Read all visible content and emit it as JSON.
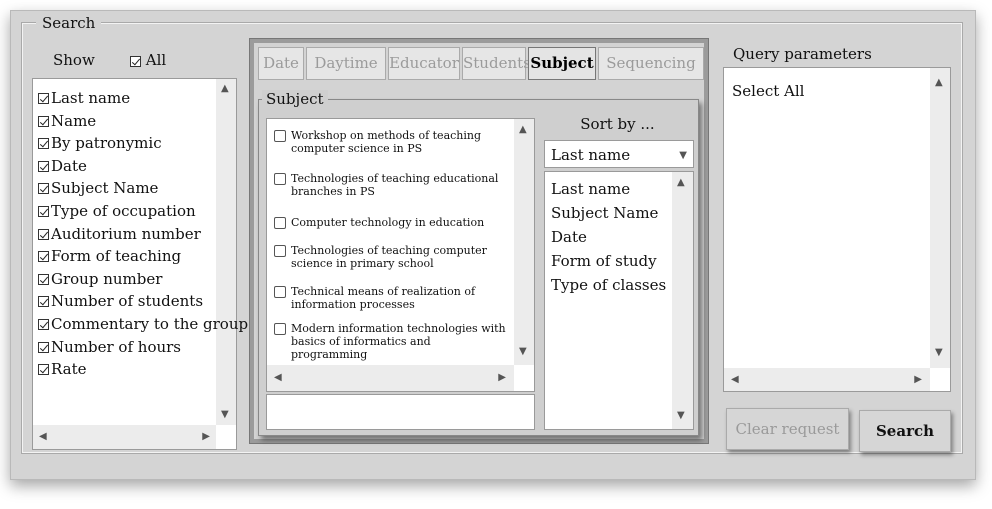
{
  "search": {
    "legend": "Search",
    "show_label": "Show",
    "all_label": "All",
    "all_checked": true,
    "fields": [
      {
        "label": "Last name",
        "checked": true
      },
      {
        "label": "Name",
        "checked": true
      },
      {
        "label": "By patronymic",
        "checked": true
      },
      {
        "label": "Date",
        "checked": true
      },
      {
        "label": "Subject Name",
        "checked": true
      },
      {
        "label": "Type of occupation",
        "checked": true
      },
      {
        "label": "Auditorium number",
        "checked": true
      },
      {
        "label": "Form of teaching",
        "checked": true
      },
      {
        "label": "Group number",
        "checked": true
      },
      {
        "label": "Number of students",
        "checked": true
      },
      {
        "label": "Commentary to the group",
        "checked": true
      },
      {
        "label": "Number of hours",
        "checked": true
      },
      {
        "label": "Rate",
        "checked": true
      }
    ]
  },
  "tabs": [
    {
      "label": "Date",
      "active": false
    },
    {
      "label": "Daytime",
      "active": false
    },
    {
      "label": "Educator",
      "active": false
    },
    {
      "label": "Students",
      "active": false
    },
    {
      "label": "Subject",
      "active": true
    },
    {
      "label": "Sequencing",
      "active": false
    }
  ],
  "subject_panel": {
    "legend": "Subject",
    "items": [
      {
        "label": "Workshop on methods of teaching computer science in PS",
        "checked": false
      },
      {
        "label": "Technologies of teaching educational branches in PS",
        "checked": false
      },
      {
        "label": "Computer technology in education",
        "checked": false
      },
      {
        "label": "Technologies of teaching computer science in primary school",
        "checked": false
      },
      {
        "label": "Technical means of realization of information processes",
        "checked": false
      },
      {
        "label": "Modern information technologies with basics of informatics and programming",
        "checked": false
      }
    ],
    "search_value": ""
  },
  "sort": {
    "header": "Sort by ...",
    "selected": "Last name",
    "options": [
      "Last name",
      "Subject Name",
      "Date",
      "Form of study",
      "Type of classes"
    ]
  },
  "query": {
    "label": "Query parameters",
    "text": "Select All"
  },
  "buttons": {
    "clear": "Clear request",
    "search": "Search"
  },
  "icons": {
    "up": "▲",
    "down": "▼",
    "left": "◀",
    "right": "▶"
  }
}
